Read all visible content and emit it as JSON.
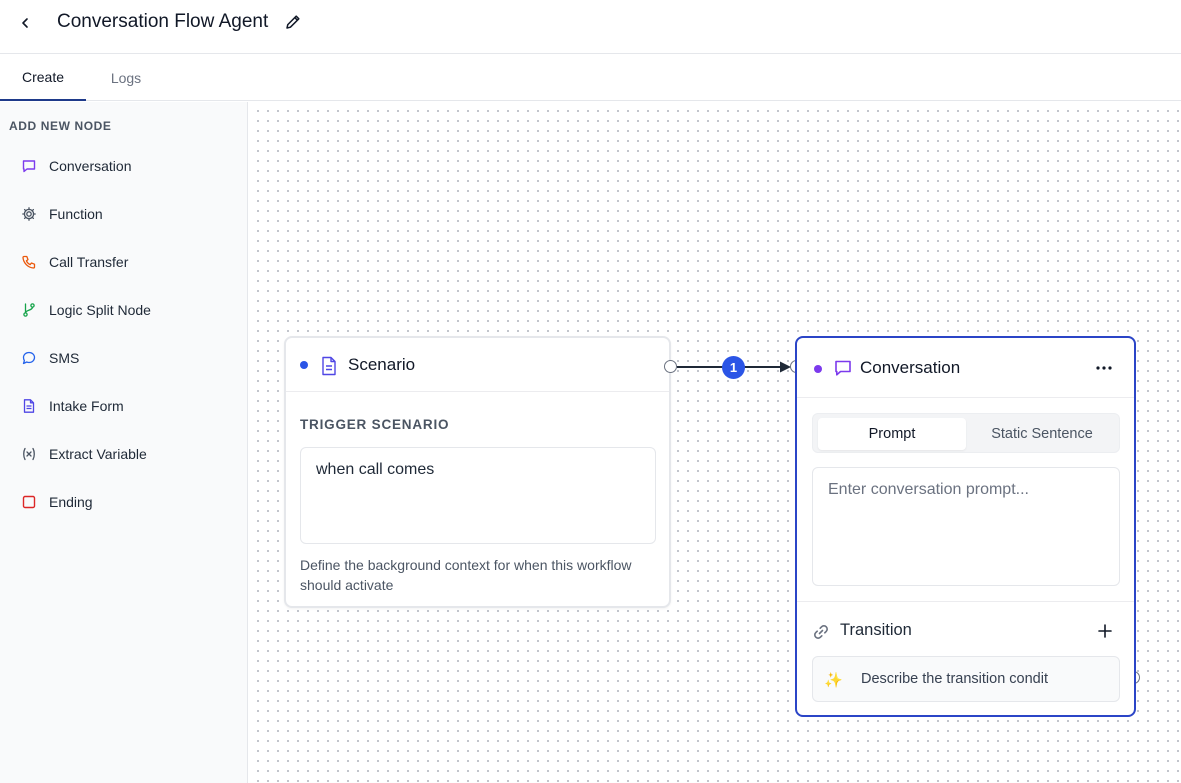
{
  "header": {
    "title": "Conversation Flow Agent"
  },
  "tabs": [
    {
      "label": "Create"
    },
    {
      "label": "Logs"
    }
  ],
  "sidebar": {
    "heading": "ADD NEW NODE",
    "items": [
      {
        "label": "Conversation",
        "icon": "message-square-icon",
        "color": "#7c3aed"
      },
      {
        "label": "Function",
        "icon": "gear-icon",
        "color": "#4b5563"
      },
      {
        "label": "Call Transfer",
        "icon": "phone-icon",
        "color": "#ea580c"
      },
      {
        "label": "Logic Split Node",
        "icon": "git-branch-icon",
        "color": "#16a34a"
      },
      {
        "label": "SMS",
        "icon": "message-circle-icon",
        "color": "#2563eb"
      },
      {
        "label": "Intake Form",
        "icon": "document-icon",
        "color": "#4f46e5"
      },
      {
        "label": "Extract Variable",
        "icon": "variable-icon",
        "color": "#4b5563"
      },
      {
        "label": "Ending",
        "icon": "square-icon",
        "color": "#dc2626"
      }
    ]
  },
  "scenario_node": {
    "title": "Scenario",
    "section_label": "TRIGGER SCENARIO",
    "trigger_value": "when call comes",
    "help_text": "Define the background context for when this workflow should activate",
    "dot_color": "#2b55e6"
  },
  "edge": {
    "label": "1"
  },
  "conversation_node": {
    "title": "Conversation",
    "dot_color": "#7c3aed",
    "segment": {
      "options": [
        "Prompt",
        "Static Sentence"
      ],
      "selected": "Prompt"
    },
    "prompt_placeholder": "Enter conversation prompt...",
    "transition_label": "Transition",
    "transition_condition_placeholder": "Describe the transition condit"
  },
  "colors": {
    "accent": "#2b45c7",
    "badge": "#2b55e6"
  }
}
